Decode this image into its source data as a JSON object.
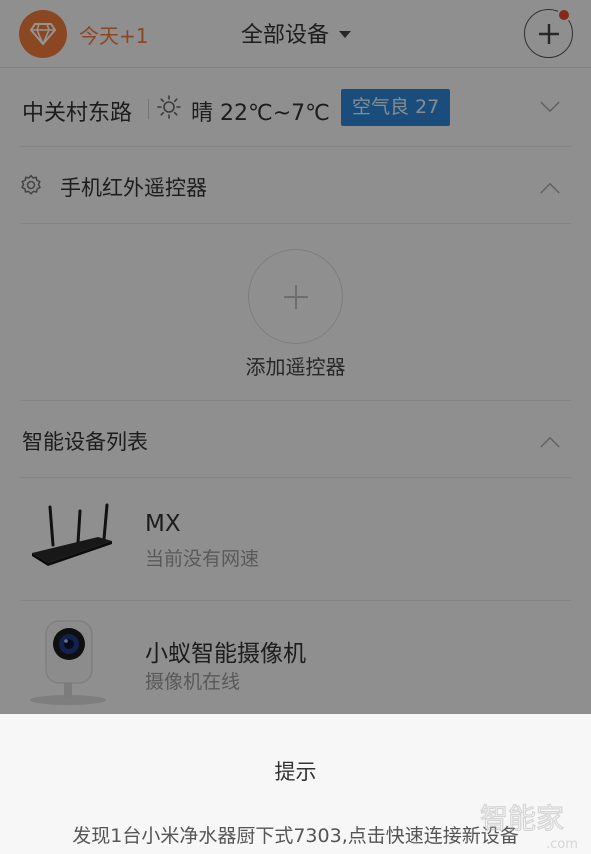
{
  "header": {
    "today_label": "今天+1",
    "device_filter": "全部设备",
    "gem_icon": "diamond-icon",
    "add_icon": "plus-icon",
    "accent": "#f07a3c",
    "badge_color": "#e8452c"
  },
  "weather": {
    "location": "中关村东路",
    "icon": "sun-icon",
    "text": "晴 22℃~7℃",
    "aqi": "空气良 27",
    "aqi_color": "#2f86d6"
  },
  "ir_remote": {
    "title": "手机红外遥控器",
    "icon": "gear-icon",
    "add_label": "添加遥控器"
  },
  "device_list": {
    "title": "智能设备列表",
    "devices": [
      {
        "name": "MX",
        "status": "当前没有网速",
        "icon": "router-icon"
      },
      {
        "name": "小蚁智能摄像机",
        "status": "摄像机在线",
        "icon": "camera-icon"
      }
    ]
  },
  "dialog": {
    "title": "提示",
    "message": "发现1台小米净水器厨下式7303,点击快速连接新设备"
  },
  "watermark": {
    "text": "智能家",
    "sub": ".com"
  }
}
